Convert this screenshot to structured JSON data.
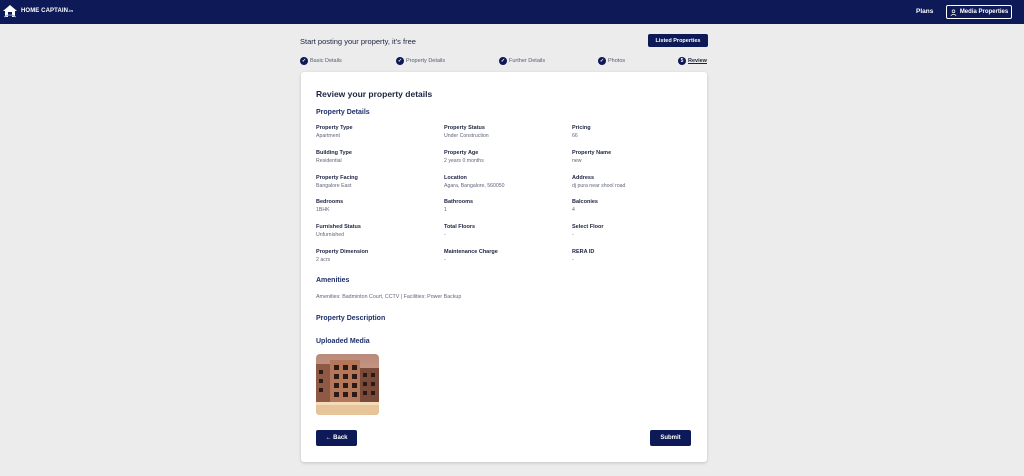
{
  "header": {
    "logo_small": "HOME CAPTAIN",
    "logo_main": "HOME CAPTAIN",
    "logo_suffix": ".in",
    "nav_plans": "Plans",
    "nav_media": "Media Properties"
  },
  "headline": "Start posting your property, it's free",
  "listed_button": "Listed Properties",
  "steps": [
    {
      "label": "Basic Details",
      "marker": "✓"
    },
    {
      "label": "Property Details",
      "marker": "✓"
    },
    {
      "label": "Further Details",
      "marker": "✓"
    },
    {
      "label": "Photos",
      "marker": "✓"
    },
    {
      "label": "Review",
      "marker": "5"
    }
  ],
  "review": {
    "title": "Review your property details",
    "property_details_heading": "Property Details",
    "fields": [
      {
        "label": "Property Type",
        "value": "Apartment"
      },
      {
        "label": "Property Status",
        "value": "Under Construction"
      },
      {
        "label": "Pricing",
        "value": "66"
      },
      {
        "label": "Building Type",
        "value": "Residential"
      },
      {
        "label": "Property Age",
        "value": "2 years 0 months"
      },
      {
        "label": "Property Name",
        "value": "new"
      },
      {
        "label": "Property Facing",
        "value": "Bangalore East"
      },
      {
        "label": "Location",
        "value": "Agara, Bangalore, 560050"
      },
      {
        "label": "Address",
        "value": "dj pura near shool road"
      },
      {
        "label": "Bedrooms",
        "value": "1BHK"
      },
      {
        "label": "Bathrooms",
        "value": "1"
      },
      {
        "label": "Balconies",
        "value": "4"
      },
      {
        "label": "Furnished Status",
        "value": "Unfurnished"
      },
      {
        "label": "Total Floors",
        "value": "-"
      },
      {
        "label": "Select Floor",
        "value": "-"
      },
      {
        "label": "Property Dimension",
        "value": "2 acrs"
      },
      {
        "label": "Maintenance Charge",
        "value": "-"
      },
      {
        "label": "RERA ID",
        "value": "-"
      }
    ],
    "amenities_heading": "Amenities",
    "amenities_text": "Amenities: Badminton Court, CCTV | Facilities: Power Backup",
    "description_heading": "Property Description",
    "media_heading": "Uploaded Media",
    "back_button": "← Back",
    "submit_button": "Submit"
  },
  "colors": {
    "navy": "#0d1a57",
    "background": "#ececec",
    "heading": "#1d2f6b"
  }
}
